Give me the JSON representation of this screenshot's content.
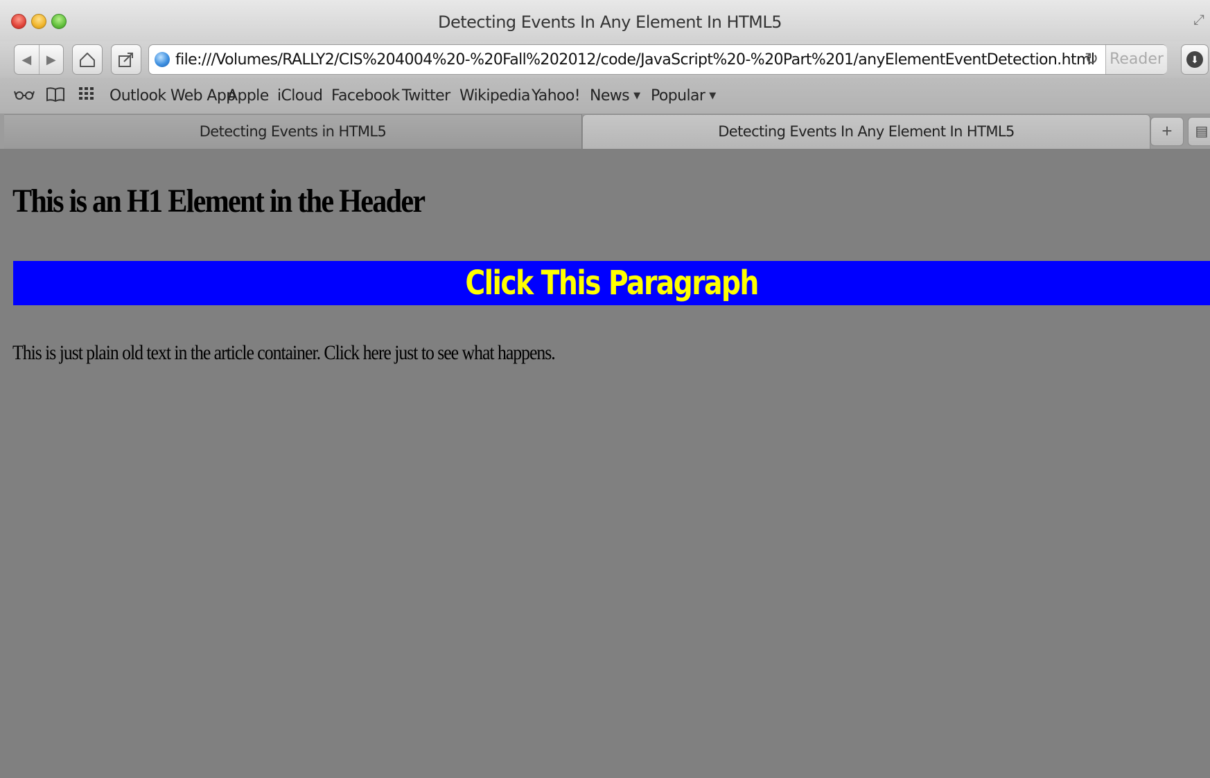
{
  "window": {
    "title": "Detecting Events In Any Element In HTML5"
  },
  "toolbar": {
    "url": "file:///Volumes/RALLY2/CIS%204004%20-%20Fall%202012/code/JavaScript%20-%20Part%201/anyElementEventDetection.html",
    "reader_label": "Reader"
  },
  "bookmarks": {
    "items": [
      {
        "label": "Outlook Web App"
      },
      {
        "label": "Apple"
      },
      {
        "label": "iCloud"
      },
      {
        "label": "Facebook"
      },
      {
        "label": "Twitter"
      },
      {
        "label": "Wikipedia"
      },
      {
        "label": "Yahoo!"
      },
      {
        "label": "News"
      },
      {
        "label": "Popular"
      }
    ]
  },
  "tabs": [
    {
      "label": "Detecting Events in HTML5",
      "active": false
    },
    {
      "label": "Detecting Events In Any Element In HTML5",
      "active": true
    }
  ],
  "page": {
    "h1": "This is an H1 Element in the Header",
    "click_paragraph": "Click This Paragraph",
    "plain_text": "This is just plain old text in the article container. Click here just to see what happens."
  },
  "colors": {
    "page_background": "#808080",
    "paragraph_background": "#0000ff",
    "paragraph_text": "#ffff00"
  }
}
